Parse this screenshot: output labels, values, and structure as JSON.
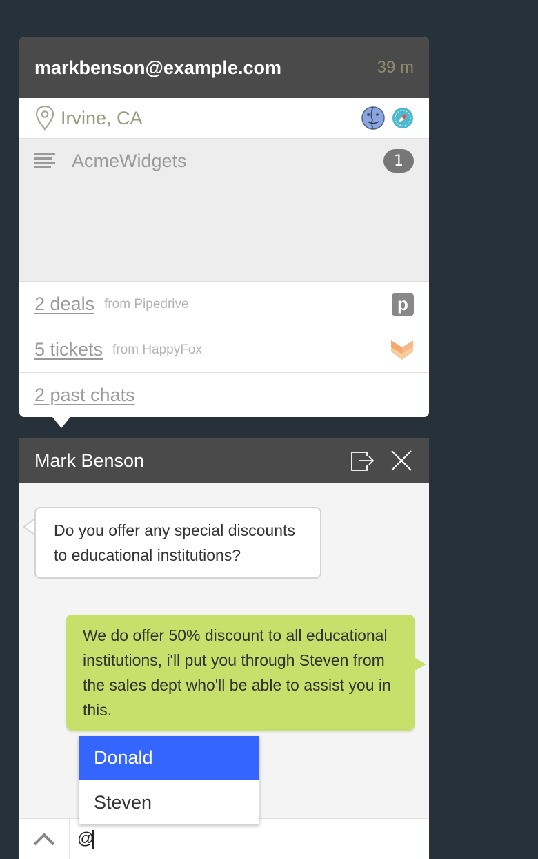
{
  "visitor": {
    "email": "markbenson@example.com",
    "elapsed": "39 m",
    "location": "Irvine, CA",
    "os_icon": "finder-icon",
    "browser_icon": "safari-icon",
    "company": "AcmeWidgets",
    "company_count": "1"
  },
  "integrations": [
    {
      "label": "2 deals",
      "source": "from Pipedrive",
      "icon": "pipedrive-icon",
      "icon_glyph": "p"
    },
    {
      "label": "5 tickets",
      "source": "from HappyFox",
      "icon": "happyfox-icon"
    },
    {
      "label": "2 past chats",
      "source": ""
    }
  ],
  "chat": {
    "name": "Mark Benson",
    "messages": [
      {
        "from": "visitor",
        "text": "Do you offer any special discounts to educational institutions?"
      },
      {
        "from": "agent",
        "text": "We do offer 50% discount to all educational institutions, i'll put you through Steven from the sales dept who'll be able to assist you in this."
      }
    ],
    "mentions": [
      {
        "name": "Donald",
        "active": true
      },
      {
        "name": "Steven",
        "active": false
      }
    ],
    "input_value": "@"
  },
  "colors": {
    "background": "#27313a",
    "header": "#4a4a4a",
    "agent_bubble": "#c6e06b",
    "mention_active": "#3465ff",
    "happyfox_orange": "#f7a86b"
  }
}
